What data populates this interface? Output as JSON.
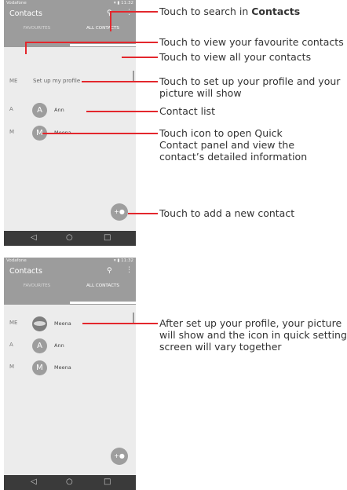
{
  "top_screen": {
    "status": {
      "carrier": "Vodafone",
      "time": "11:32"
    },
    "title": "Contacts",
    "tabs": {
      "favourites": "FAVOURITES",
      "all": "ALL CONTACTS"
    },
    "profile_row": {
      "section": "ME",
      "text": "Set up my profile"
    },
    "contacts": [
      {
        "section": "A",
        "initial": "A",
        "name": "Ann"
      },
      {
        "section": "M",
        "initial": "M",
        "name": "Meena"
      }
    ]
  },
  "bottom_screen": {
    "status": {
      "carrier": "Vodafone",
      "time": "11:32"
    },
    "title": "Contacts",
    "tabs": {
      "favourites": "FAVOURITES",
      "all": "ALL CONTACTS"
    },
    "contacts": [
      {
        "section": "ME",
        "name": "Meena"
      },
      {
        "section": "A",
        "initial": "A",
        "name": "Ann"
      },
      {
        "section": "M",
        "initial": "M",
        "name": "Meena"
      }
    ]
  },
  "annotations": {
    "search_prefix": "Touch to search in ",
    "search_bold": "Contacts",
    "favourites": "Touch to view your favourite contacts",
    "all_contacts": "Touch to view all your contacts",
    "profile_line1": "Touch to set up your profile and your",
    "profile_line2": "picture will show",
    "contact_list": "Contact list",
    "quick_line1": "Touch icon to open Quick",
    "quick_line2": "Contact panel and view the",
    "quick_line3": "contact’s detailed information",
    "add_contact": "Touch to add a new contact",
    "after_line1": "After set up your profile, your picture",
    "after_line2": "will show and the icon in quick setting",
    "after_line3": "screen will vary together"
  },
  "icons": [
    "search-icon",
    "more-icon",
    "add-contact-icon",
    "back-icon",
    "home-icon",
    "recents-icon"
  ],
  "colors": {
    "callout": "#e3272d",
    "appbar": "#9c9c9c",
    "navbar": "#3a3a3a"
  }
}
